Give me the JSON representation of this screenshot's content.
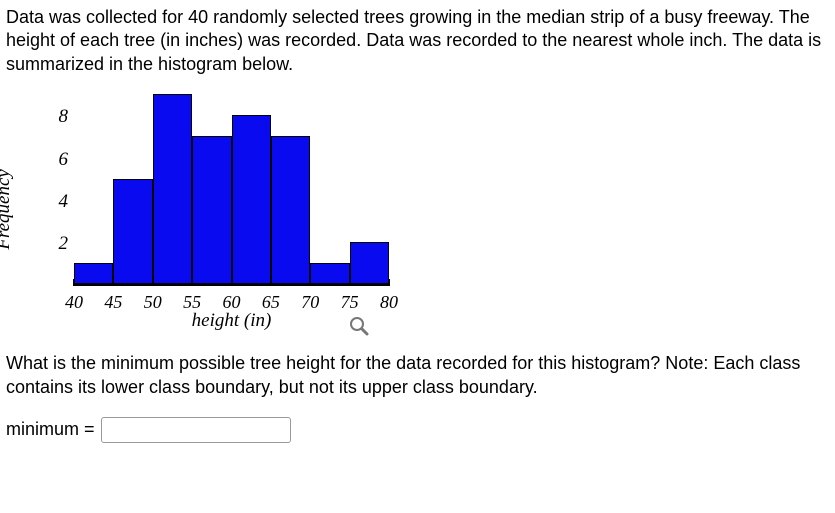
{
  "intro": "Data was collected for 40 randomly selected trees growing in the median strip of a busy freeway. The height of each tree (in inches) was recorded. Data was recorded to the nearest whole inch. The data is summarized in the histogram below.",
  "chart_data": {
    "type": "bar",
    "categories": [
      "40-45",
      "45-50",
      "50-55",
      "55-60",
      "60-65",
      "65-70",
      "70-75",
      "75-80"
    ],
    "values": [
      1,
      5,
      9,
      7,
      8,
      7,
      1,
      2
    ],
    "x_ticks": [
      40,
      45,
      50,
      55,
      60,
      65,
      70,
      75,
      80
    ],
    "y_ticks": [
      2,
      4,
      6,
      8
    ],
    "xlabel": "height (in)",
    "ylabel": "Frequency",
    "ylim": [
      0,
      9
    ],
    "title": ""
  },
  "question": "What is the minimum possible tree height for the data recorded for this histogram? Note: Each class contains its lower class boundary, but not its upper class boundary.",
  "answer": {
    "label": "minimum =",
    "value": ""
  }
}
